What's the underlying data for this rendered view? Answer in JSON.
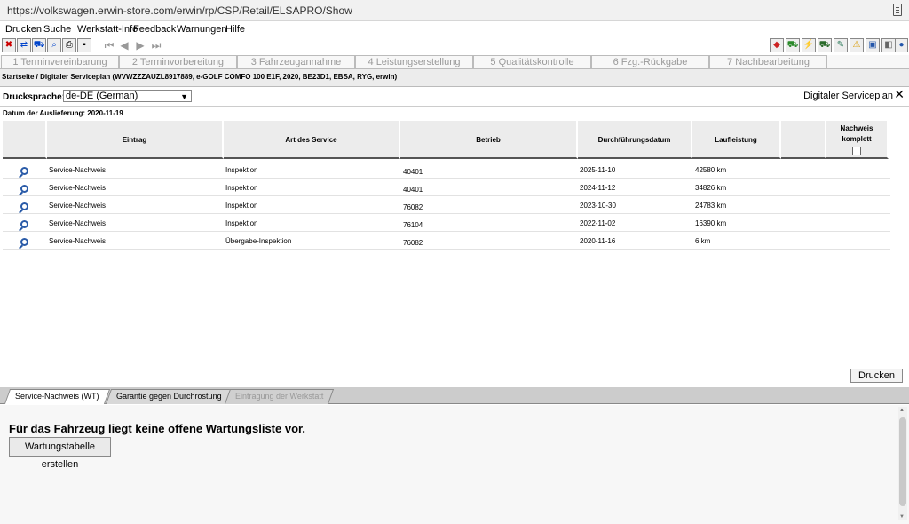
{
  "browser": {
    "url": "https://volkswagen.erwin-store.com/erwin/rp/CSP/Retail/ELSAPRO/Show"
  },
  "menu": [
    "Drucken",
    "Suche",
    "Werkstatt-Info",
    "Feedback",
    "Warnungen",
    "Hilfe"
  ],
  "steps": [
    "1 Terminvereinbarung",
    "2 Terminvorbereitung",
    "3 Fahrzeugannahme",
    "4 Leistungserstellung",
    "5 Qualitätskontrolle",
    "6 Fzg.-Rückgabe",
    "7 Nachbearbeitung"
  ],
  "breadcrumb": "Startseite / Digitaler Serviceplan (WVWZZZAUZL8917889, e-GOLF COMFO 100 E1F, 2020, BE23D1, EBSA, RYG, erwin)",
  "print_lang": {
    "label": "Drucksprache:",
    "value": "de-DE (German)"
  },
  "panel_title": "Digitaler Serviceplan",
  "delivery_date": "Datum der Auslieferung: 2020-11-19",
  "table": {
    "headers": [
      "Eintrag",
      "Art des Service",
      "Betrieb",
      "Durchführungsdatum",
      "Laufleistung",
      "Nachweis komplett"
    ],
    "rows": [
      [
        "Service-Nachweis",
        "Inspektion",
        "40401",
        "2025-11-10",
        "42580 km"
      ],
      [
        "Service-Nachweis",
        "Inspektion",
        "40401",
        "2024-11-12",
        "34826 km"
      ],
      [
        "Service-Nachweis",
        "Inspektion",
        "76082",
        "2023-10-30",
        "24783 km"
      ],
      [
        "Service-Nachweis",
        "Inspektion",
        "76104",
        "2022-11-02",
        "16390 km"
      ],
      [
        "Service-Nachweis",
        "Übergabe-Inspektion",
        "76082",
        "2020-11-16",
        "6 km"
      ]
    ]
  },
  "print_button": "Drucken",
  "tabs": [
    "Service-Nachweis (WT)",
    "Garantie gegen Durchrostung",
    "Eintragung der Werkstatt"
  ],
  "lower": {
    "message": "Für das Fahrzeug liegt keine offene Wartungsliste vor.",
    "button": "Wartungstabelle erstellen"
  }
}
